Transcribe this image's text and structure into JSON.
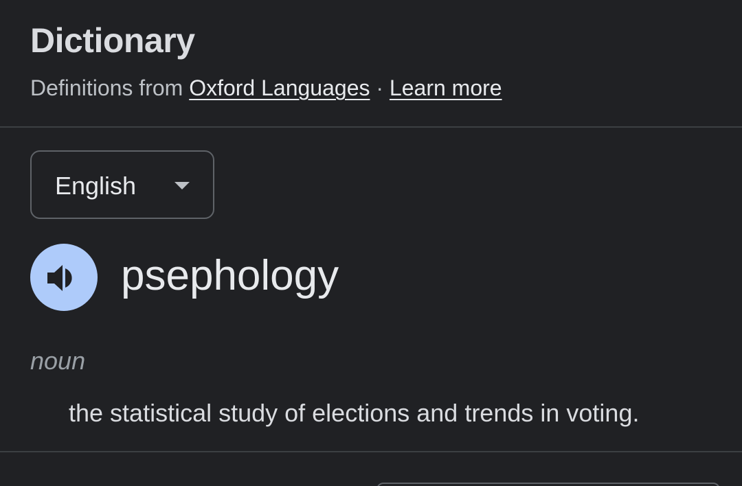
{
  "header": {
    "title": "Dictionary",
    "subtitle_prefix": "Definitions from ",
    "source_link": "Oxford Languages",
    "separator": " · ",
    "learn_more_link": "Learn more"
  },
  "language_select": {
    "selected": "English",
    "icon": "chevron-down-icon"
  },
  "entry": {
    "pronounce_icon": "speaker-icon",
    "word": "psephology",
    "part_of_speech": "noun",
    "definition": "the statistical study of elections and trends in voting."
  },
  "colors": {
    "background": "#202124",
    "speaker_button": "#aecbfa",
    "speaker_glyph": "#202124",
    "divider": "#3c4043",
    "border": "#5f6368"
  }
}
